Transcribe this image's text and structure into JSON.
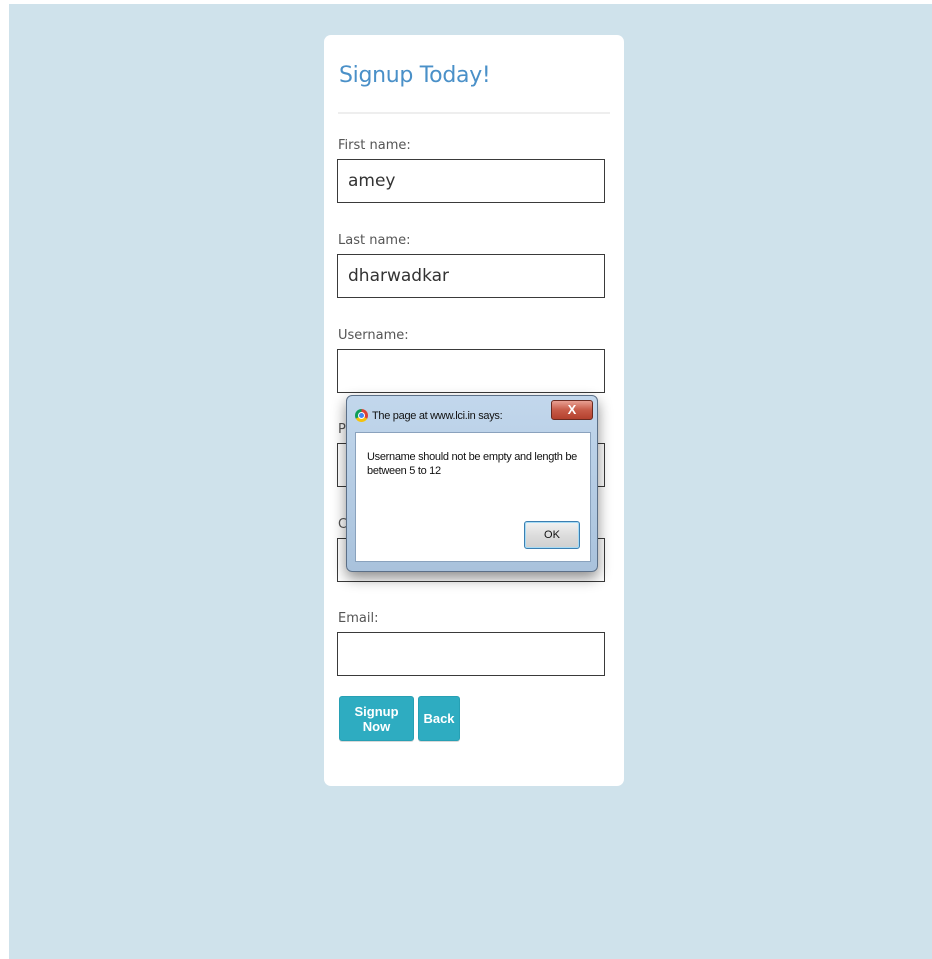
{
  "form": {
    "title": "Signup Today!",
    "fields": {
      "first_name": {
        "label": "First name:",
        "value": "amey"
      },
      "last_name": {
        "label": "Last name:",
        "value": "dharwadkar"
      },
      "username": {
        "label": "Username:",
        "value": ""
      },
      "password": {
        "label": "Pa",
        "value": ""
      },
      "confirm": {
        "label": "Co",
        "value": ""
      },
      "email": {
        "label": "Email:",
        "value": ""
      }
    },
    "signup_label": "Signup Now",
    "back_label": "Back"
  },
  "dialog": {
    "caption": "The page at www.lci.in says:",
    "close_label": "X",
    "message": "Username should not be empty and length be between 5 to 12",
    "ok_label": "OK",
    "icon": "chrome-icon"
  },
  "colors": {
    "background": "#cfe2eb",
    "title": "#4a90c8",
    "button": "#2eacc1"
  }
}
